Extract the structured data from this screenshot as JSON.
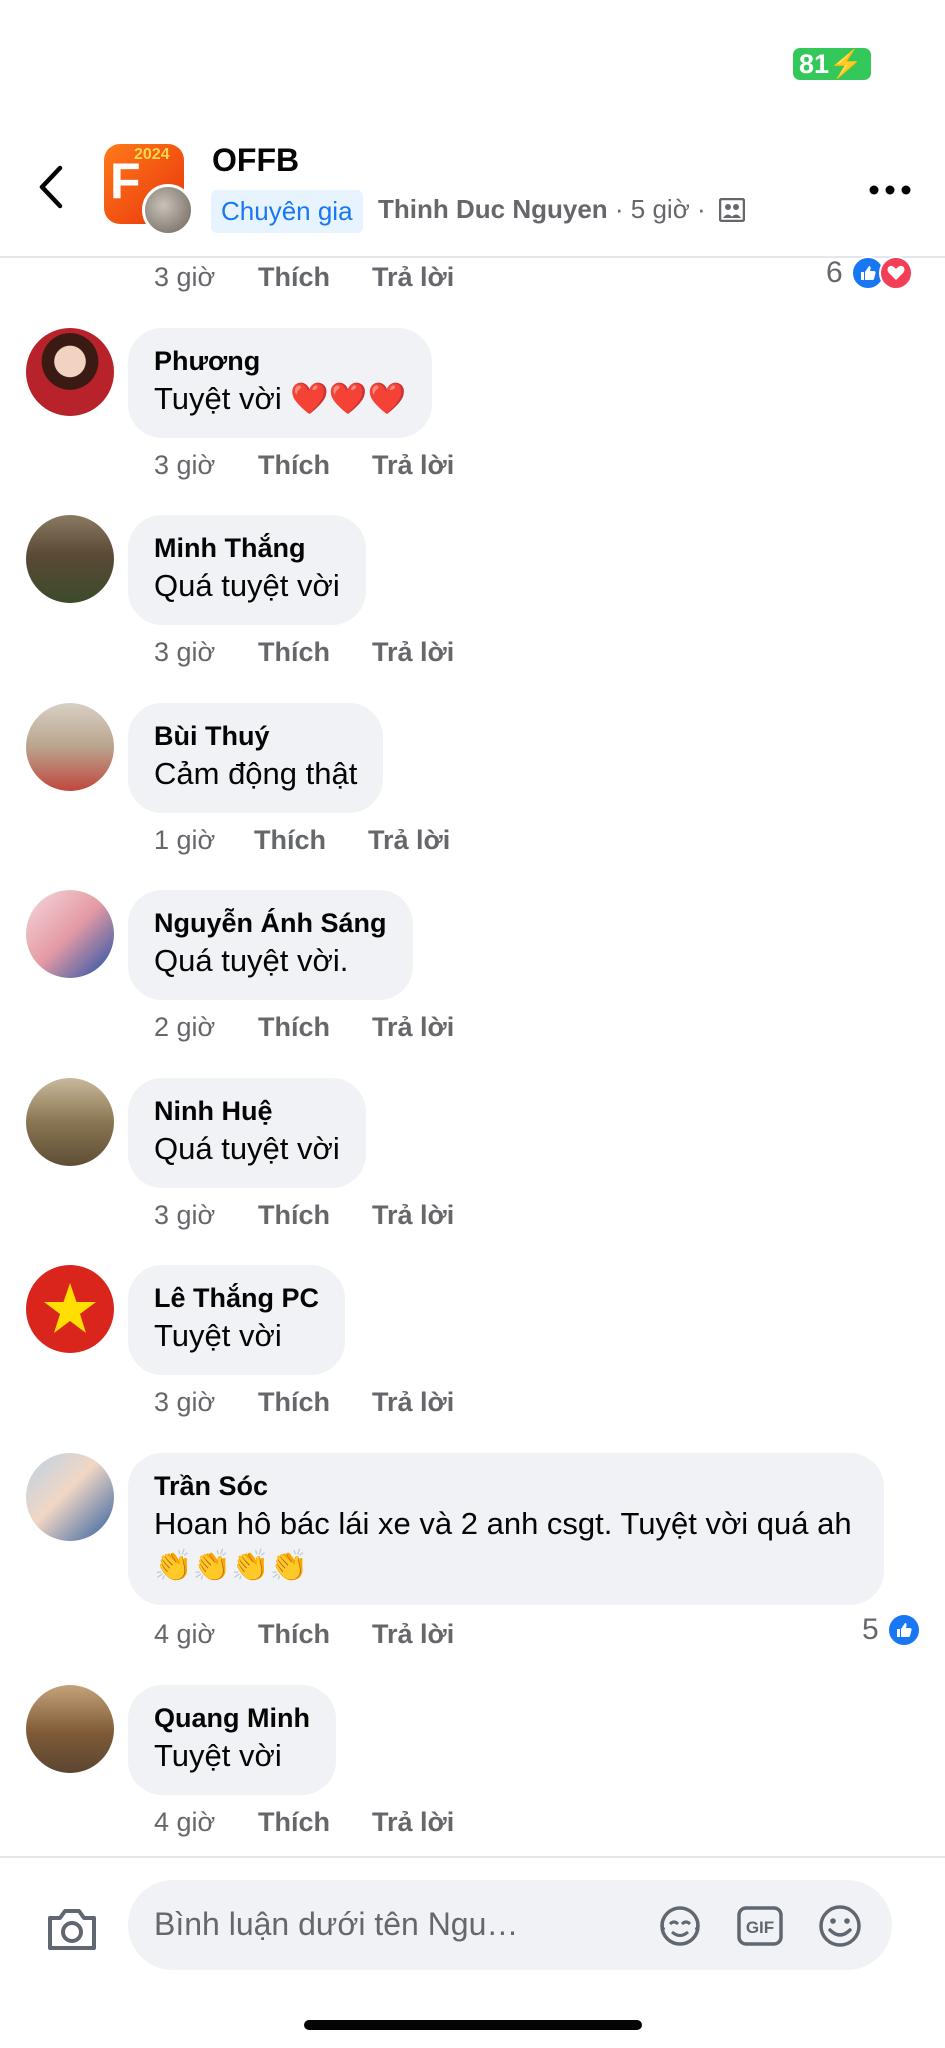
{
  "status": {
    "battery": "81"
  },
  "header": {
    "page_name": "OFFB",
    "logo_year": "2024",
    "badge": "Chuyên gia",
    "author": "Thinh Duc Nguyen",
    "time": "· 5 giờ ·",
    "icons": {
      "back": "chevron-left-icon",
      "privacy": "friends-group-icon",
      "more": "more-dots-icon"
    }
  },
  "top_partial": {
    "time": "3 giờ",
    "like": "Thích",
    "reply": "Trả lời",
    "reaction_count": "6"
  },
  "comments": [
    {
      "name": "Phương",
      "text": "Tuyệt vời ❤️❤️❤️",
      "time": "3 giờ",
      "like": "Thích",
      "reply": "Trả lời"
    },
    {
      "name": "Minh Thắng",
      "text": "Quá tuyệt vời",
      "time": "3 giờ",
      "like": "Thích",
      "reply": "Trả lời"
    },
    {
      "name": "Bùi Thuý",
      "text": "Cảm động thật",
      "time": "1 giờ",
      "like": "Thích",
      "reply": "Trả lời"
    },
    {
      "name": "Nguyễn Ánh Sáng",
      "text": "Quá tuyệt vời.",
      "time": "2 giờ",
      "like": "Thích",
      "reply": "Trả lời"
    },
    {
      "name": "Ninh Huệ",
      "text": "Quá tuyệt vời",
      "time": "3 giờ",
      "like": "Thích",
      "reply": "Trả lời"
    },
    {
      "name": "Lê Thắng PC",
      "text": "Tuyệt vời",
      "time": "3 giờ",
      "like": "Thích",
      "reply": "Trả lời"
    },
    {
      "name": "Trần Sóc",
      "text": "Hoan hô bác lái xe và 2 anh csgt. Tuyệt vời quá ah 👏👏👏👏",
      "time": "4 giờ",
      "like": "Thích",
      "reply": "Trả lời",
      "reaction_count": "5"
    },
    {
      "name": "Quang Minh",
      "text": "Tuyệt vời",
      "time": "4 giờ",
      "like": "Thích",
      "reply": "Trả lời"
    }
  ],
  "composer": {
    "placeholder": "Bình luận dưới tên Nguyễn M...",
    "icons": [
      "camera-icon",
      "avatar-sticker-icon",
      "gif-icon",
      "emoji-icon"
    ]
  },
  "colors": {
    "accent": "#1877f2",
    "love": "#f33e58",
    "bubble": "#f0f2f5",
    "secondary_text": "#65676b"
  }
}
